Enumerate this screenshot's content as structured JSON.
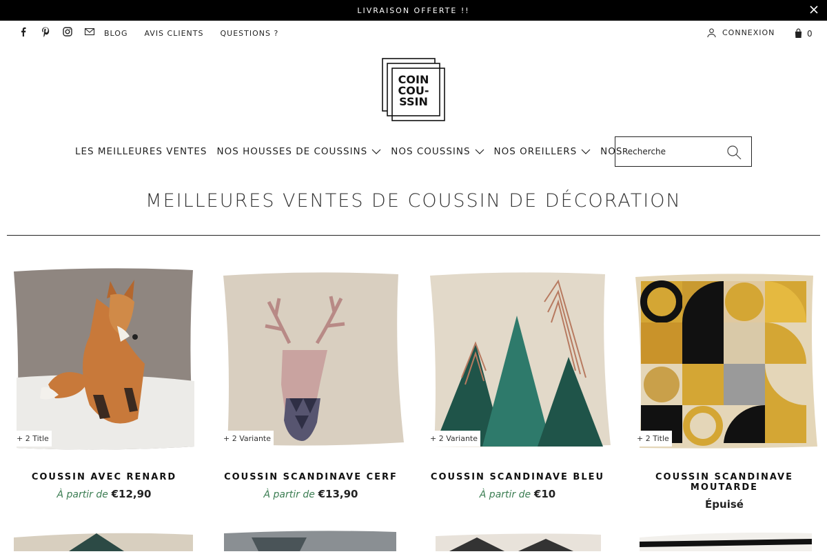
{
  "announcement": {
    "text": "LIVRAISON OFFERTE !!"
  },
  "utility_nav": {
    "links": [
      "BLOG",
      "AVIS CLIENTS",
      "QUESTIONS ?"
    ],
    "login_label": "CONNEXION",
    "cart_count": "0"
  },
  "logo": {
    "lines": [
      "COIN",
      "COU-",
      "SSIN"
    ]
  },
  "main_nav": {
    "items": [
      {
        "label": "LES MEILLEURES VENTES",
        "dropdown": false
      },
      {
        "label": "NOS HOUSSES DE COUSSINS",
        "dropdown": true
      },
      {
        "label": "NOS COUSSINS",
        "dropdown": true
      },
      {
        "label": "NOS OREILLERS",
        "dropdown": true
      },
      {
        "label": "NOS POUFS",
        "dropdown": true
      }
    ]
  },
  "search": {
    "placeholder": "Recherche"
  },
  "page": {
    "title": "MEILLEURES VENTES DE COUSSIN DE DÉCORATION"
  },
  "products": [
    {
      "name": "COUSSIN AVEC RENARD",
      "badge": "+ 2 Title",
      "price_prefix": "À partir de",
      "price": "€12,90"
    },
    {
      "name": "COUSSIN SCANDINAVE CERF",
      "badge": "+ 2 Variante",
      "price_prefix": "À partir de",
      "price": "€13,90"
    },
    {
      "name": "COUSSIN SCANDINAVE BLEU",
      "badge": "+ 2 Variante",
      "price_prefix": "À partir de",
      "price": "€10"
    },
    {
      "name": "COUSSIN SCANDINAVE MOUTARDE",
      "badge": "+ 2 Title",
      "price_prefix": "",
      "price": "Épuisé"
    }
  ],
  "colors": {
    "accent_green": "#3b7d52",
    "text": "#222222",
    "topbar": "#000000"
  }
}
